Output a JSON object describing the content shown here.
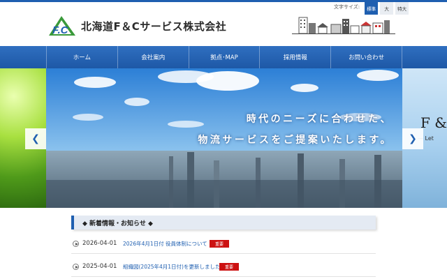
{
  "header": {
    "logo_text": "F.C",
    "company_name": "北海道F＆Cサービス株式会社",
    "font_size": {
      "label": "文字サイズ:",
      "options": [
        "標準",
        "大",
        "特大"
      ],
      "selected": "標準"
    }
  },
  "nav": {
    "items": [
      "ホーム",
      "会社案内",
      "拠点･MAP",
      "採用情報",
      "お問い合わせ"
    ]
  },
  "hero": {
    "line1": "時代のニーズに合わせた、",
    "line2": "物流サービスをご提案いたします。",
    "next_slide_title": "F &",
    "next_slide_sub": "— Let"
  },
  "news": {
    "heading": "◆ 新着情報・お知らせ ◆",
    "items": [
      {
        "date": "2026-04-01",
        "title": "2026年4月1日付 役員体制について",
        "badge": "重要"
      },
      {
        "date": "2025-04-01",
        "title": "組織図(2025年4月1日付)を更新しました",
        "badge": "重要"
      }
    ]
  },
  "colors": {
    "brand_blue": "#1f5fb0",
    "badge_red": "#cc1111",
    "logo_green": "#3a9a3a"
  }
}
